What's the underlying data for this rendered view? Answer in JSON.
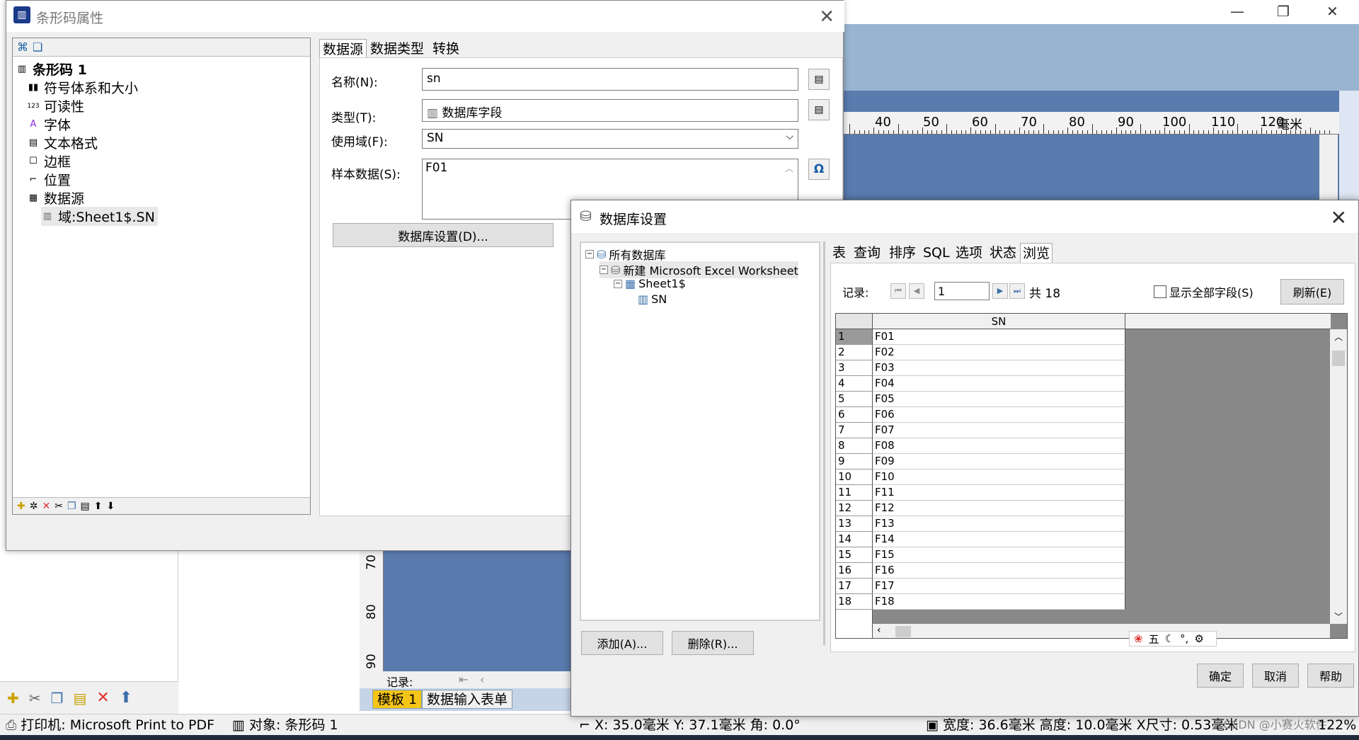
{
  "barcode_dialog": {
    "title": "条形码属性",
    "tree": [
      {
        "icon": "barcode-icon",
        "label": "条形码 1"
      },
      {
        "icon": "symbology-icon",
        "label": "符号体系和大小"
      },
      {
        "icon": "readability-icon",
        "label": "可读性"
      },
      {
        "icon": "font-icon",
        "label": "字体"
      },
      {
        "icon": "text-format-icon",
        "label": "文本格式"
      },
      {
        "icon": "border-icon",
        "label": "边框"
      },
      {
        "icon": "position-icon",
        "label": "位置"
      },
      {
        "icon": "datasource-icon",
        "label": "数据源"
      },
      {
        "icon": "field-icon",
        "label": "域:Sheet1$.SN"
      }
    ],
    "tabs": [
      "数据源",
      "数据类型",
      "转换"
    ],
    "name_label": "名称(N):",
    "name_value": "sn",
    "type_label": "类型(T):",
    "type_value": "数据库字段",
    "domain_label": "使用域(F):",
    "domain_value": "SN",
    "sample_label": "样本数据(S):",
    "sample_value": "F01",
    "omega_symbol": "Ω",
    "db_settings_button": "数据库设置(D)..."
  },
  "db_dialog": {
    "title": "数据库设置",
    "tree": [
      {
        "label": "所有数据库",
        "expander": "−"
      },
      {
        "label": "新建 Microsoft Excel Worksheet",
        "expander": "−"
      },
      {
        "label": "Sheet1$",
        "expander": "−"
      },
      {
        "label": "SN"
      }
    ],
    "add_button": "添加(A)...",
    "delete_button": "删除(R)...",
    "tabs": [
      "表",
      "查询",
      "排序",
      "SQL",
      "选项",
      "状态",
      "浏览"
    ],
    "record_label": "记录:",
    "record_value": "1",
    "record_total": "共 18",
    "show_all_fields": "显示全部字段(S)",
    "refresh_button": "刷新(E)",
    "grid_column": "SN",
    "rows": [
      {
        "n": "1",
        "v": "F01"
      },
      {
        "n": "2",
        "v": "F02"
      },
      {
        "n": "3",
        "v": "F03"
      },
      {
        "n": "4",
        "v": "F04"
      },
      {
        "n": "5",
        "v": "F05"
      },
      {
        "n": "6",
        "v": "F06"
      },
      {
        "n": "7",
        "v": "F07"
      },
      {
        "n": "8",
        "v": "F08"
      },
      {
        "n": "9",
        "v": "F09"
      },
      {
        "n": "10",
        "v": "F10"
      },
      {
        "n": "11",
        "v": "F11"
      },
      {
        "n": "12",
        "v": "F12"
      },
      {
        "n": "13",
        "v": "F13"
      },
      {
        "n": "14",
        "v": "F14"
      },
      {
        "n": "15",
        "v": "F15"
      },
      {
        "n": "16",
        "v": "F16"
      },
      {
        "n": "17",
        "v": "F17"
      },
      {
        "n": "18",
        "v": "F18"
      }
    ],
    "ime_label": "五",
    "ok_button": "确定",
    "cancel_button": "取消",
    "help_button": "帮助"
  },
  "background": {
    "ruler_labels": [
      "40",
      "50",
      "60",
      "70",
      "80",
      "90",
      "100",
      "110",
      "120"
    ],
    "ruler_unit": "毫米",
    "vruler_labels": [
      "70",
      "80",
      "90"
    ],
    "record_label": "记录:",
    "doc_tabs": [
      "模板 1",
      "数据输入表单"
    ],
    "status": {
      "printer": "打印机: Microsoft Print to PDF",
      "object": "对象: 条形码 1",
      "position": "X: 35.0毫米  Y: 37.1毫米  角: 0.0°",
      "size": "宽度: 36.6毫米  高度: 10.0毫米  X尺寸: 0.53毫米",
      "zoom": "122%",
      "watermark": "CSDN @小赛火软件"
    }
  }
}
